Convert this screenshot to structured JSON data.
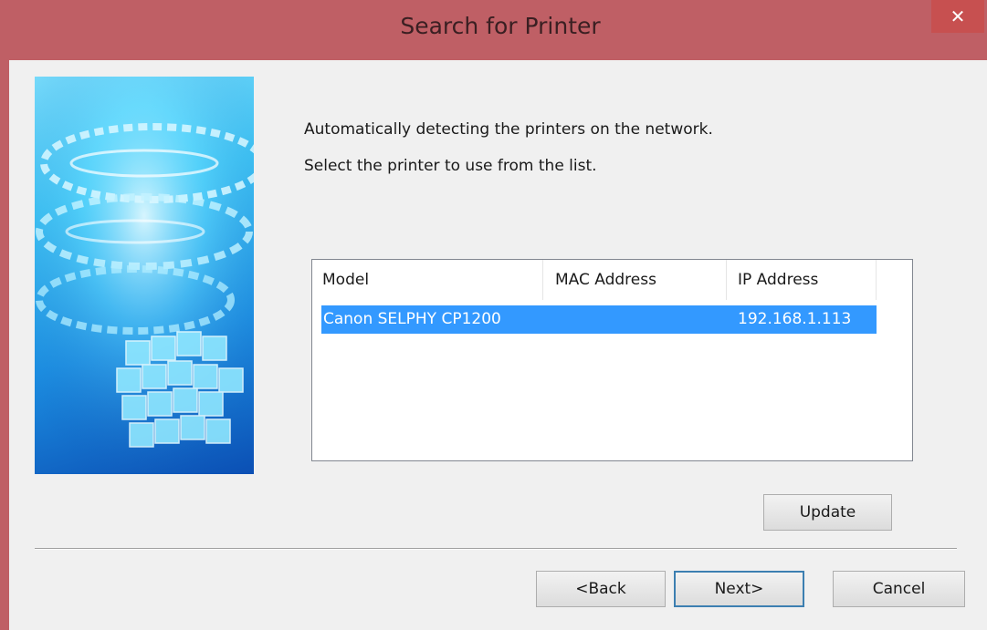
{
  "window": {
    "title": "Search for Printer",
    "close_label": "✕",
    "accent_color": "#bf5f65"
  },
  "content": {
    "line1": "Automatically detecting the printers on the network.",
    "line2": "Select the printer to use from the list."
  },
  "printer_list": {
    "columns": [
      "Model",
      "MAC Address",
      "IP Address"
    ],
    "rows": [
      {
        "model": "Canon SELPHY CP1200",
        "mac": "",
        "ip": "192.168.1.113",
        "selected": true
      }
    ]
  },
  "buttons": {
    "update": "Update",
    "back": "<Back",
    "next": "Next>",
    "cancel": "Cancel"
  }
}
